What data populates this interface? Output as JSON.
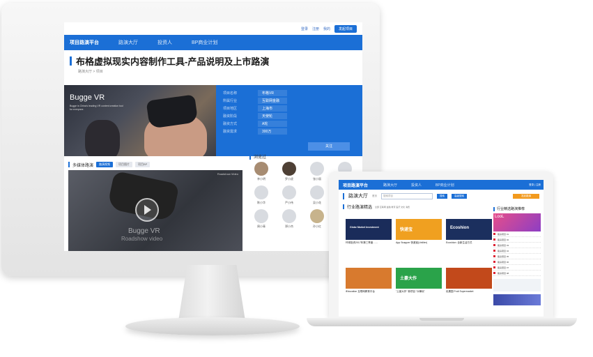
{
  "desktop": {
    "topbar": {
      "items": [
        "登录",
        "注册",
        "我的"
      ],
      "button": "发起项目"
    },
    "nav": {
      "brand": "项目路演平台",
      "items": [
        "路演大厅",
        "投资人",
        "BP商业计划"
      ]
    },
    "title": "布格虚拟现实内容制作工具-产品说明及上市路演",
    "breadcrumb": "路演大厅 > 项目",
    "hero": {
      "brand": "Bugge VR",
      "blurb": "Bugge is China's leading VR content creation tool for everyone.",
      "info": [
        {
          "k": "项目名称",
          "v": "布格VR"
        },
        {
          "k": "所属行业",
          "v": "互联网金融"
        },
        {
          "k": "项目地区",
          "v": "上海市"
        },
        {
          "k": "融资阶段",
          "v": "天使轮"
        },
        {
          "k": "融资方式",
          "v": "A轮"
        },
        {
          "k": "融资需求",
          "v": "300万"
        }
      ],
      "button": "关注"
    },
    "media": {
      "title": "多媒体路演",
      "tabs": [
        "路演视频",
        "项目图片",
        "项目BP"
      ],
      "tag": "Roadshow Video",
      "overlay1": "Bugge VR",
      "overlay2": "Roadshow video"
    },
    "viewed": {
      "title": "浏览过",
      "people": [
        "李小明",
        "罗小虎",
        "张小丽",
        "刘小军",
        "陈小华",
        "严小伟",
        "吴小花",
        "王小强",
        "周小青",
        "郑小杰",
        "孙小红",
        "黄小天"
      ]
    }
  },
  "laptop": {
    "nav": {
      "brand": "项目路演平台",
      "items": [
        "路演大厅",
        "投资人",
        "BP商业计划"
      ],
      "right": "登录 | 注册"
    },
    "sub": {
      "title": "路演大厅",
      "crumb": "首页",
      "search_placeholder": "搜索项目",
      "search_btn": "搜索",
      "btn2": "高级搜索",
      "cta": "发起路演"
    },
    "section": {
      "title": "行业路演精选",
      "filters": "全部 互联网 金融 教育 医疗 文化 消费"
    },
    "cards": [
      {
        "label": "Globe Market Investment",
        "title": "环球投资2017年第三季度……",
        "color": "#1a2c5a"
      },
      {
        "label": "快递宝",
        "title": "App Snapper 快递宝(Uniliter)",
        "color": "#f0a020"
      },
      {
        "label": "Ecoshion",
        "title": "Ecoshion: 全新生活方式",
        "color": "#1b2f5e"
      },
      {
        "label": "",
        "title": "iEducation 互联网教育平台",
        "color": "#d87a2e"
      },
      {
        "label": "土豪大作",
        "title": "\"土豪大作\" 新项目 \"众筹玩\"",
        "color": "#2aa34a"
      },
      {
        "label": "",
        "title": "优果园 Fruit Supermarket",
        "color": "#c2491b"
      }
    ],
    "side": {
      "title": "行业精选路演推荐",
      "banner": "LooL",
      "items": [
        "路演项目 01",
        "路演项目 02",
        "路演项目 03",
        "路演项目 04",
        "路演项目 05",
        "路演项目 06",
        "路演项目 07",
        "路演项目 08"
      ]
    }
  }
}
